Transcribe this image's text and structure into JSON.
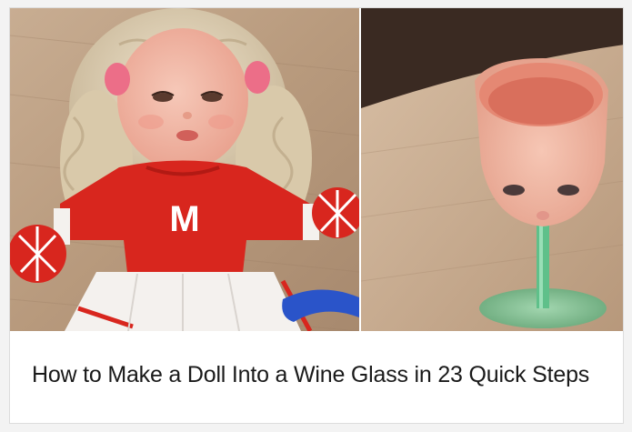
{
  "card": {
    "photos": {
      "left": {
        "content": "doll-cheerleader-photo",
        "sweater_letter": "M"
      },
      "right": {
        "content": "doll-head-wine-glass-photo"
      }
    },
    "caption": "How to Make a Doll Into a Wine Glass in 23 Quick Steps"
  },
  "colors": {
    "sweater_red": "#d8261e",
    "skirt_white": "#f4f1ee",
    "skin_pink": "#f2b3a1",
    "stem_green": "#5fc08a",
    "wood_tan": "#c9a789",
    "scissors_blue": "#2a54c9"
  }
}
